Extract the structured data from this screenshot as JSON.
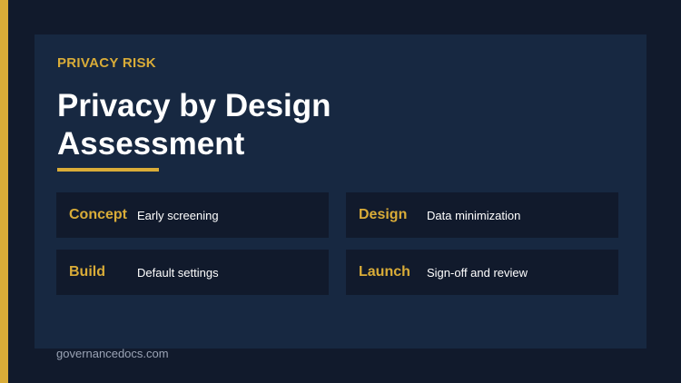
{
  "eyebrow": "PRIVACY RISK",
  "title_line1": "Privacy by Design",
  "title_line2": "Assessment",
  "cards": [
    {
      "label": "Concept",
      "text": "Early screening"
    },
    {
      "label": "Design",
      "text": "Data minimization"
    },
    {
      "label": "Build",
      "text": "Default settings"
    },
    {
      "label": "Launch",
      "text": "Sign-off and review"
    }
  ],
  "footer": "governancedocs.com",
  "colors": {
    "background": "#111a2c",
    "panel": "#172841",
    "accent": "#d9ac38",
    "text": "#ffffff",
    "muted": "#9aa3b5"
  }
}
